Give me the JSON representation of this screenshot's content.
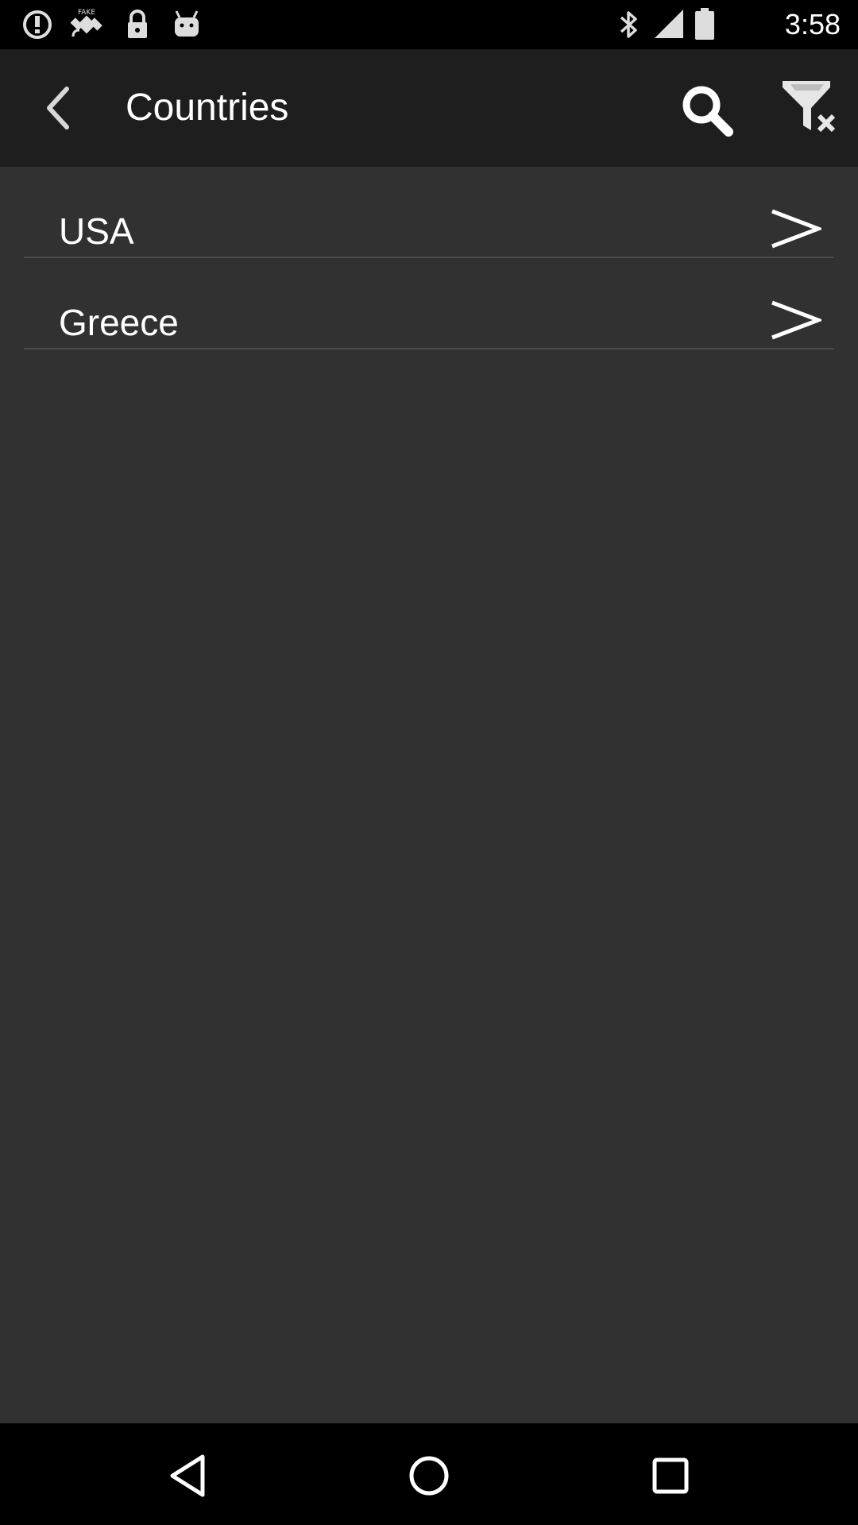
{
  "status_bar": {
    "time": "3:58",
    "left_icons": [
      "alert-icon",
      "fake-gps-icon",
      "lock-icon",
      "android-icon"
    ],
    "right_icons": [
      "bluetooth-icon",
      "signal-icon",
      "battery-icon"
    ]
  },
  "app_bar": {
    "title": "Countries",
    "back_icon": "back-arrow-icon",
    "actions": [
      "search-icon",
      "clear-filter-icon"
    ]
  },
  "countries": [
    {
      "label": "USA"
    },
    {
      "label": "Greece"
    }
  ],
  "nav_bar": {
    "buttons": [
      "back-triangle-icon",
      "home-circle-icon",
      "recents-square-icon"
    ]
  },
  "colors": {
    "background": "#313131",
    "app_bar": "#1e1e1e",
    "status_bar": "#000000",
    "text": "#ffffff",
    "divider": "#4a4a4a"
  }
}
